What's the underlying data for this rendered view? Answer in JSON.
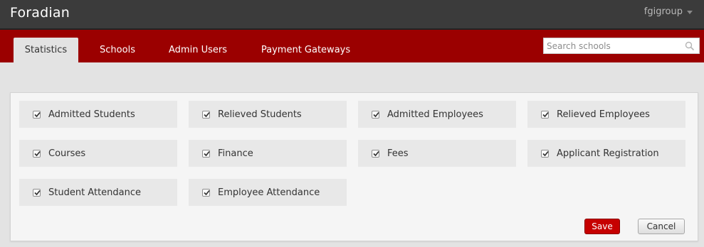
{
  "header": {
    "brand": "Foradian",
    "user": "fgigroup",
    "user_menu_icon": "caret-down-icon"
  },
  "nav": {
    "tabs": [
      {
        "label": "Statistics",
        "active": true
      },
      {
        "label": "Schools",
        "active": false
      },
      {
        "label": "Admin Users",
        "active": false
      },
      {
        "label": "Payment Gateways",
        "active": false
      }
    ],
    "search": {
      "placeholder": "Search schools",
      "value": "",
      "icon": "search-icon"
    }
  },
  "options": [
    {
      "label": "Admitted Students",
      "checked": true
    },
    {
      "label": "Relieved Students",
      "checked": true
    },
    {
      "label": "Admitted Employees",
      "checked": true
    },
    {
      "label": "Relieved Employees",
      "checked": true
    },
    {
      "label": "Courses",
      "checked": true
    },
    {
      "label": "Finance",
      "checked": true
    },
    {
      "label": "Fees",
      "checked": true
    },
    {
      "label": "Applicant Registration",
      "checked": true
    },
    {
      "label": "Student Attendance",
      "checked": true
    },
    {
      "label": "Employee Attendance",
      "checked": true
    }
  ],
  "actions": {
    "save_label": "Save",
    "cancel_label": "Cancel"
  },
  "colors": {
    "topbar": "#3b3b3b",
    "navbar": "#9b0000",
    "save_button": "#c60000",
    "page_background": "#e3e3e3"
  }
}
